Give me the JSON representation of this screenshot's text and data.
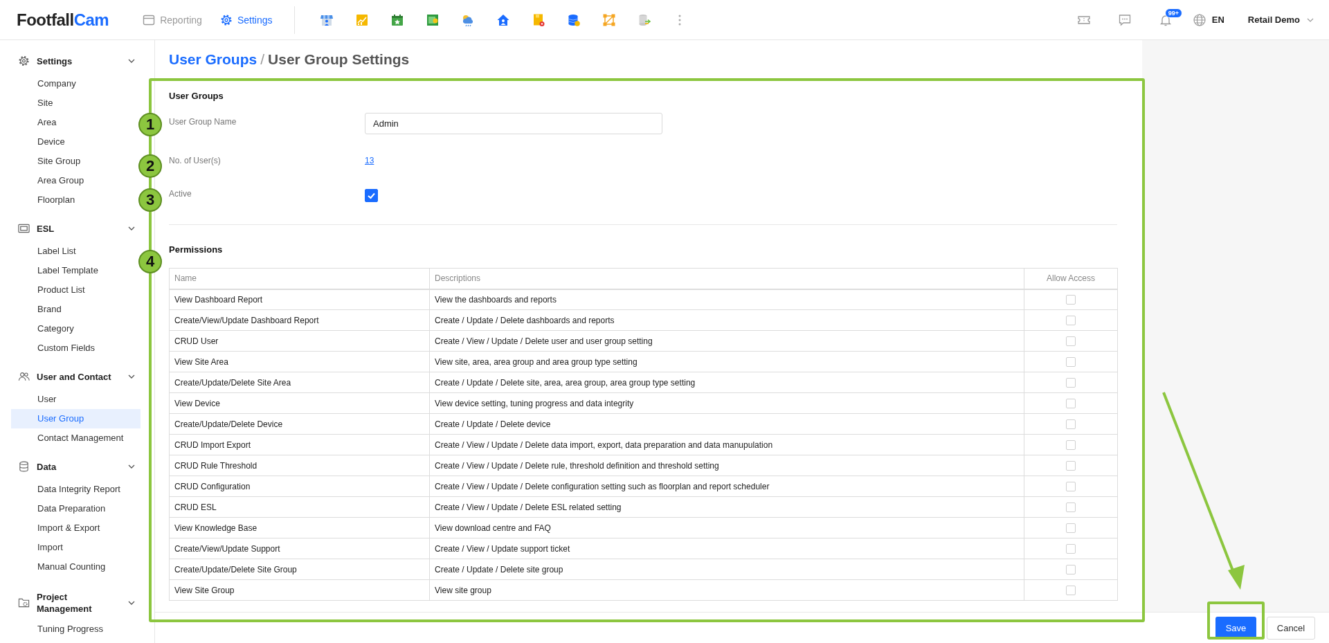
{
  "header": {
    "logo_dark": "Footfall",
    "logo_accent": "Cam",
    "nav": [
      {
        "label": "Reporting",
        "selected": false
      },
      {
        "label": "Settings",
        "selected": true
      }
    ],
    "notification_badge": "99+",
    "language": "EN",
    "account": "Retail Demo"
  },
  "sidebar": {
    "sections": [
      {
        "title": "Settings",
        "expanded": true,
        "items": [
          {
            "label": "Company",
            "selected": false
          },
          {
            "label": "Site",
            "selected": false
          },
          {
            "label": "Area",
            "selected": false
          },
          {
            "label": "Device",
            "selected": false
          },
          {
            "label": "Site Group",
            "selected": false
          },
          {
            "label": "Area Group",
            "selected": false
          },
          {
            "label": "Floorplan",
            "selected": false
          }
        ]
      },
      {
        "title": "ESL",
        "expanded": true,
        "items": [
          {
            "label": "Label List",
            "selected": false
          },
          {
            "label": "Label Template",
            "selected": false
          },
          {
            "label": "Product List",
            "selected": false
          },
          {
            "label": "Brand",
            "selected": false
          },
          {
            "label": "Category",
            "selected": false
          },
          {
            "label": "Custom Fields",
            "selected": false
          }
        ]
      },
      {
        "title": "User and Contact",
        "expanded": true,
        "items": [
          {
            "label": "User",
            "selected": false
          },
          {
            "label": "User Group",
            "selected": true
          },
          {
            "label": "Contact Management",
            "selected": false
          }
        ]
      },
      {
        "title": "Data",
        "expanded": true,
        "items": [
          {
            "label": "Data Integrity Report",
            "selected": false
          },
          {
            "label": "Data Preparation",
            "selected": false
          },
          {
            "label": "Import & Export",
            "selected": false
          },
          {
            "label": "Import",
            "selected": false
          },
          {
            "label": "Manual Counting",
            "selected": false
          }
        ]
      },
      {
        "title": "Project Management",
        "expanded": true,
        "items": [
          {
            "label": "Tuning Progress",
            "selected": false
          }
        ]
      }
    ]
  },
  "breadcrumb": {
    "parent": "User Groups",
    "separator": "/",
    "current": "User Group Settings"
  },
  "form": {
    "title": "User Groups",
    "fields": [
      {
        "kind": "text",
        "label": "User Group Name",
        "value": "Admin"
      },
      {
        "kind": "link",
        "label": "No. of User(s)",
        "value": "13"
      },
      {
        "kind": "checkbox",
        "label": "Active",
        "checked": true
      }
    ]
  },
  "permissions": {
    "title": "Permissions",
    "columns": [
      "Name",
      "Descriptions",
      "Allow Access"
    ],
    "rows": [
      {
        "name": "View Dashboard Report",
        "description": "View the dashboards and reports",
        "allowed": false
      },
      {
        "name": "Create/View/Update Dashboard Report",
        "description": "Create / Update / Delete dashboards and reports",
        "allowed": false
      },
      {
        "name": "CRUD User",
        "description": "Create / View / Update / Delete user and user group setting",
        "allowed": false
      },
      {
        "name": "View Site Area",
        "description": "View site, area, area group and area group type setting",
        "allowed": false
      },
      {
        "name": "Create/Update/Delete Site Area",
        "description": "Create / Update / Delete site, area, area group, area group type setting",
        "allowed": false
      },
      {
        "name": "View Device",
        "description": "View device setting, tuning progress and data integrity",
        "allowed": false
      },
      {
        "name": "Create/Update/Delete Device",
        "description": "Create / Update / Delete device",
        "allowed": false
      },
      {
        "name": "CRUD Import Export",
        "description": "Create / View / Update / Delete data import, export, data preparation and data manupulation",
        "allowed": false
      },
      {
        "name": "CRUD Rule Threshold",
        "description": "Create / View / Update / Delete rule, threshold definition and threshold setting",
        "allowed": false
      },
      {
        "name": "CRUD Configuration",
        "description": "Create / View / Update / Delete configuration setting such as floorplan and report scheduler",
        "allowed": false
      },
      {
        "name": "CRUD ESL",
        "description": "Create / View / Update / Delete ESL related setting",
        "allowed": false
      },
      {
        "name": "View Knowledge Base",
        "description": "View download centre and FAQ",
        "allowed": false
      },
      {
        "name": "Create/View/Update Support",
        "description": "Create / View / Update support ticket",
        "allowed": false
      },
      {
        "name": "Create/Update/Delete Site Group",
        "description": "Create / Update / Delete site group",
        "allowed": false
      },
      {
        "name": "View Site Group",
        "description": "View site group",
        "allowed": false
      }
    ]
  },
  "footer": {
    "buttons": [
      {
        "label": "Save",
        "kind": "primary"
      },
      {
        "label": "Cancel",
        "kind": "secondary"
      }
    ]
  },
  "annotations": {
    "markers": [
      "1",
      "2",
      "3",
      "4"
    ]
  }
}
